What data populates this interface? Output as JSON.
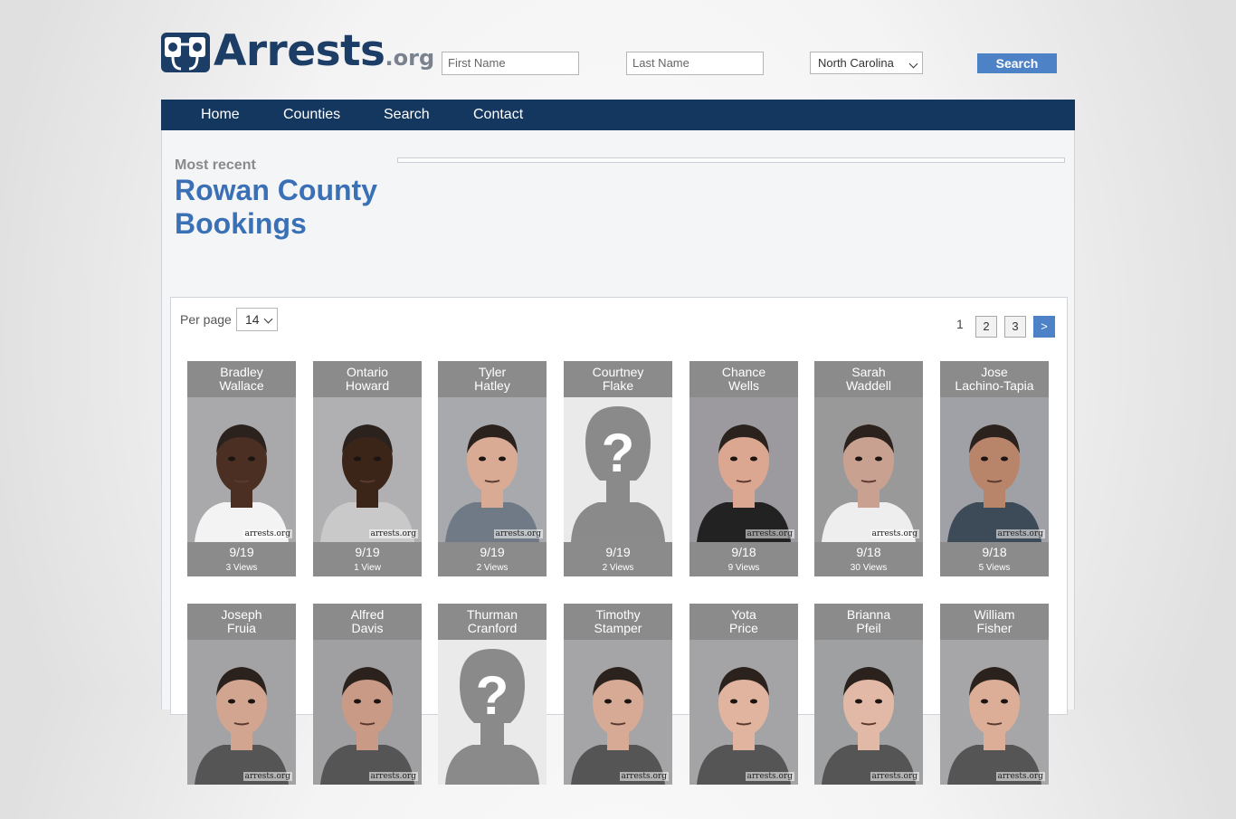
{
  "site": {
    "name": "Arrests",
    "tld": ".org"
  },
  "search": {
    "first_placeholder": "First Name",
    "last_placeholder": "Last Name",
    "state": "North Carolina",
    "button": "Search"
  },
  "nav": [
    "Home",
    "Counties",
    "Search",
    "Contact"
  ],
  "heading": {
    "kicker": "Most recent",
    "title": "Rowan County Bookings"
  },
  "list": {
    "per_page_label": "Per page",
    "per_page_value": "14",
    "pages": [
      "1",
      "2",
      "3"
    ],
    "next_label": ">"
  },
  "watermark": "arrests.org",
  "bookings": [
    {
      "first": "Bradley",
      "last": "Wallace",
      "date": "9/19",
      "views": "3 Views",
      "has_photo": true,
      "skin": "#4a2f22",
      "shirt": "#f3f3f3",
      "bg": "#a9a9ab"
    },
    {
      "first": "Ontario",
      "last": "Howard",
      "date": "9/19",
      "views": "1 View",
      "has_photo": true,
      "skin": "#3b2519",
      "shirt": "#c9c9c9",
      "bg": "#b0b0b2"
    },
    {
      "first": "Tyler",
      "last": "Hatley",
      "date": "9/19",
      "views": "2 Views",
      "has_photo": true,
      "skin": "#d9ab94",
      "shirt": "#6f7a86",
      "bg": "#a8a9ad"
    },
    {
      "first": "Courtney",
      "last": "Flake",
      "date": "9/19",
      "views": "2 Views",
      "has_photo": false
    },
    {
      "first": "Chance",
      "last": "Wells",
      "date": "9/18",
      "views": "9 Views",
      "has_photo": true,
      "skin": "#dba790",
      "shirt": "#222222",
      "bg": "#9c9a9e"
    },
    {
      "first": "Sarah",
      "last": "Waddell",
      "date": "9/18",
      "views": "30 Views",
      "has_photo": true,
      "skin": "#c9a190",
      "shirt": "#eeeeee",
      "bg": "#9a9999"
    },
    {
      "first": "Jose",
      "last": "Lachino-Tapia",
      "date": "9/18",
      "views": "5 Views",
      "has_photo": true,
      "skin": "#b8846a",
      "shirt": "#3d4a58",
      "bg": "#9fa1a6"
    },
    {
      "first": "Joseph",
      "last": "Fruia",
      "date": "",
      "views": "",
      "has_photo": true,
      "skin": "#d2a590",
      "shirt": "#555555",
      "bg": "#a3a3a5"
    },
    {
      "first": "Alfred",
      "last": "Davis",
      "date": "",
      "views": "",
      "has_photo": true,
      "skin": "#c99a85",
      "shirt": "#555555",
      "bg": "#a0a0a2"
    },
    {
      "first": "Thurman",
      "last": "Cranford",
      "date": "",
      "views": "",
      "has_photo": false
    },
    {
      "first": "Timothy",
      "last": "Stamper",
      "date": "",
      "views": "",
      "has_photo": true,
      "skin": "#d7aa95",
      "shirt": "#555555",
      "bg": "#a5a5a7"
    },
    {
      "first": "Yota",
      "last": "Price",
      "date": "",
      "views": "",
      "has_photo": true,
      "skin": "#e0b49f",
      "shirt": "#555555",
      "bg": "#a4a4a6"
    },
    {
      "first": "Brianna",
      "last": "Pfeil",
      "date": "",
      "views": "",
      "has_photo": true,
      "skin": "#e2b9a6",
      "shirt": "#555555",
      "bg": "#9fa0a2"
    },
    {
      "first": "William",
      "last": "Fisher",
      "date": "",
      "views": "",
      "has_photo": true,
      "skin": "#dcae98",
      "shirt": "#555555",
      "bg": "#a6a6a8"
    }
  ],
  "colors": {
    "brand": "#1c3d66",
    "nav": "#143760",
    "accent": "#4e82c6",
    "title": "#3a70b5",
    "card": "#8b8b8b"
  }
}
